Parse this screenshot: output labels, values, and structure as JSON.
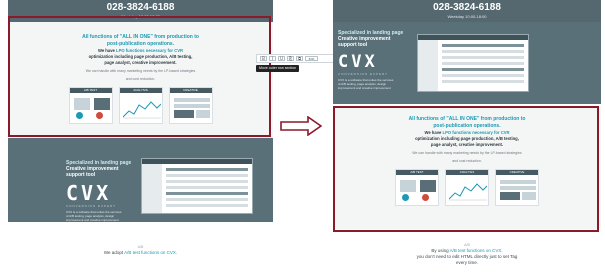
{
  "header": {
    "phone": "028-3824-6188",
    "hours": "Weekday 10:00-18:00"
  },
  "features": {
    "head1": "All functions of \"ALL IN ONE\" from production to",
    "head2": "post-publication operations.",
    "lead_prefix": "We have ",
    "lead_highlight": "LPO functions necessary for CVR",
    "lead_rest1": "optimization including page production, A/B testing,",
    "lead_rest2": "page analyst, creative improvement.",
    "sub1": "We can handle with many marketing needs by the LP-based strategies",
    "sub2": "and cost reduction.",
    "cards": [
      {
        "title": "A/B TEST"
      },
      {
        "title": "ANALYSIS"
      },
      {
        "title": "CREATIVE"
      }
    ]
  },
  "cvx": {
    "line1": "Specialized in landing page",
    "line2": "Creative improvement",
    "line3": "support tool",
    "logo": "CVX",
    "tag": "CONVERSION EXPERT",
    "desc1": "CVX is a software that unites the services",
    "desc2": "of A/B testing, page analysis, design",
    "desc3": "improvement and creative improvement"
  },
  "bottom": {
    "small": "A/B",
    "left_line_prefix": "We adopt ",
    "left_line_highlight": "A/B test functions on CVX.",
    "right_line_prefix": "By using ",
    "right_line_highlight": "A/B test functions on CVX,",
    "right_line2": "you don't need to edit HTML directly just to set Tag",
    "right_line3": "every time."
  },
  "toolbar": {
    "icons": [
      "B",
      "I",
      "U",
      "⎘",
      "⧉",
      "Edit"
    ],
    "tooltip": "Move outer row section"
  },
  "colors": {
    "header_bg": "#556870",
    "accent": "#1c9ab3",
    "highlight_border": "#8a1a2a",
    "cvx_bg": "#5a7079"
  }
}
